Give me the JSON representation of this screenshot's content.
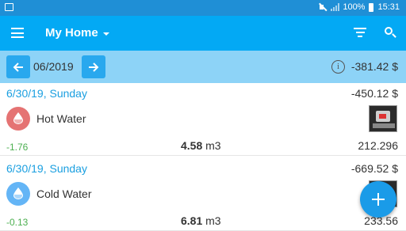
{
  "status_bar": {
    "battery": "100%",
    "time": "15:31"
  },
  "app_bar": {
    "title": "My Home",
    "icons": [
      "menu-icon",
      "chevron-down-icon",
      "filter-icon",
      "search-icon"
    ]
  },
  "period": {
    "label": "06/2019",
    "total": "-381.42 $"
  },
  "entries": [
    {
      "date": "6/30/19, Sunday",
      "amount": "-450.12 $",
      "name": "Hot Water",
      "diff": "-1.76",
      "usage_value": "4.58",
      "usage_unit": "m3",
      "reading": "212.296",
      "icon_color": "#e57373"
    },
    {
      "date": "6/30/19, Sunday",
      "amount": "-669.52 $",
      "name": "Cold Water",
      "diff": "-0.13",
      "usage_value": "6.81",
      "usage_unit": "m3",
      "reading": "233.56",
      "icon_color": "#64b5f6"
    }
  ],
  "colors": {
    "app_bar": "#03a9f4",
    "status_bar": "#1f8fd6",
    "period_bar": "#8dd3f7",
    "accent_text": "#1a9fe0",
    "positive_diff": "#4caf50",
    "fab": "#1a9be8"
  }
}
